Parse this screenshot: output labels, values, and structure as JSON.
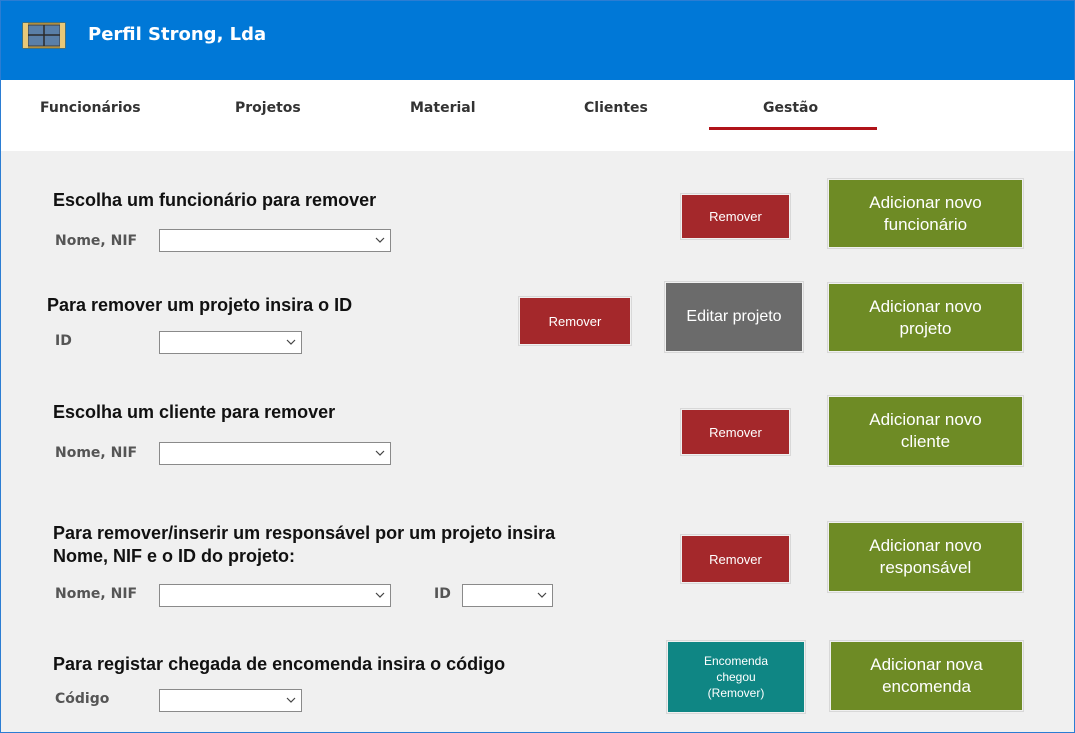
{
  "app": {
    "title": "Perfil Strong, Lda",
    "logo_icon": "window-frame-icon"
  },
  "tabs": [
    {
      "label": "Funcionários"
    },
    {
      "label": "Projetos"
    },
    {
      "label": "Material"
    },
    {
      "label": "Clientes"
    },
    {
      "label": "Gestão",
      "active": true
    }
  ],
  "sections": {
    "funcionario": {
      "heading": "Escolha um funcionário para remover",
      "field_label": "Nome, NIF",
      "select_value": "",
      "remove_label": "Remover",
      "add_line1": "Adicionar novo",
      "add_line2": "funcionário"
    },
    "projeto": {
      "heading": "Para remover um projeto insira o ID",
      "field_label": "ID",
      "select_value": "",
      "remove_label": "Remover",
      "edit_label": "Editar projeto",
      "add_line1": "Adicionar novo",
      "add_line2": "projeto"
    },
    "cliente": {
      "heading": "Escolha um cliente para remover",
      "field_label": "Nome, NIF",
      "select_value": "",
      "remove_label": "Remover",
      "add_line1": "Adicionar novo",
      "add_line2": "cliente"
    },
    "responsavel": {
      "heading_line1": "Para remover/inserir um responsável por um projeto insira",
      "heading_line2": "Nome, NIF e o ID do projeto:",
      "name_label": "Nome, NIF",
      "id_label": "ID",
      "name_select_value": "",
      "id_select_value": "",
      "remove_label": "Remover",
      "add_line1": "Adicionar novo",
      "add_line2": "responsável"
    },
    "encomenda": {
      "heading": "Para registar chegada de encomenda insira o código",
      "field_label": "Código",
      "select_value": "",
      "arrived_line1": "Encomenda",
      "arrived_line2": "chegou",
      "arrived_line3": "(Remover)",
      "add_line1": "Adicionar nova",
      "add_line2": "encomenda"
    }
  },
  "colors": {
    "titlebar": "#0078d7",
    "tab_underline": "#b01319",
    "remove_button": "#a4282b",
    "add_button": "#6e8b25",
    "edit_button": "#6b6b6b",
    "arrived_button": "#0f8684"
  }
}
